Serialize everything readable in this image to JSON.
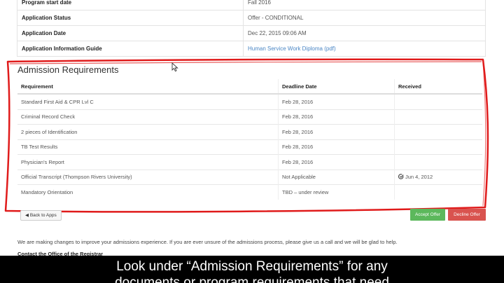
{
  "app_info": {
    "rows": [
      {
        "label": "Program start date",
        "value": "Fall 2016"
      },
      {
        "label": "Application Status",
        "value": "Offer - CONDITIONAL"
      },
      {
        "label": "Application Date",
        "value": "Dec 22, 2015 09:06 AM"
      },
      {
        "label": "Application Information Guide",
        "value": "Human Service Work Diploma (pdf)"
      }
    ]
  },
  "requirements": {
    "title": "Admission Requirements",
    "headers": {
      "requirement": "Requirement",
      "deadline": "Deadline Date",
      "received": "Received"
    },
    "rows": [
      {
        "requirement": "Standard First Aid & CPR Lvl C",
        "deadline": "Feb 28, 2016",
        "received": ""
      },
      {
        "requirement": "Criminal Record Check",
        "deadline": "Feb 28, 2016",
        "received": ""
      },
      {
        "requirement": "2 pieces of Identification",
        "deadline": "Feb 28, 2016",
        "received": ""
      },
      {
        "requirement": "TB Test Results",
        "deadline": "Feb 28, 2016",
        "received": ""
      },
      {
        "requirement": "Physician's Report",
        "deadline": "Feb 28, 2016",
        "received": ""
      },
      {
        "requirement": "Official Transcript (Thompson Rivers University)",
        "deadline": "Not Applicable",
        "received": "Jun 4, 2012"
      },
      {
        "requirement": "Mandatory Orientation",
        "deadline": "TBD – under review",
        "received": ""
      }
    ]
  },
  "actions": {
    "back_label": "Back to Apps",
    "accept_label": "Accept Offer",
    "decline_label": "Decline Offer"
  },
  "footer": {
    "notice": "We are making changes to improve your admissions experience. If you are ever unsure of the admissions process, please give us a call and we will be glad to help.",
    "contact_heading": "Contact the Office of the Registrar"
  },
  "caption": {
    "line1": "Look under “Admission Requirements” for any",
    "line2": "documents or program requirements that need"
  },
  "colors": {
    "annotation": "#e01b1b",
    "accept": "#5cb85c",
    "decline": "#d9534f",
    "link": "#4a86c5"
  }
}
